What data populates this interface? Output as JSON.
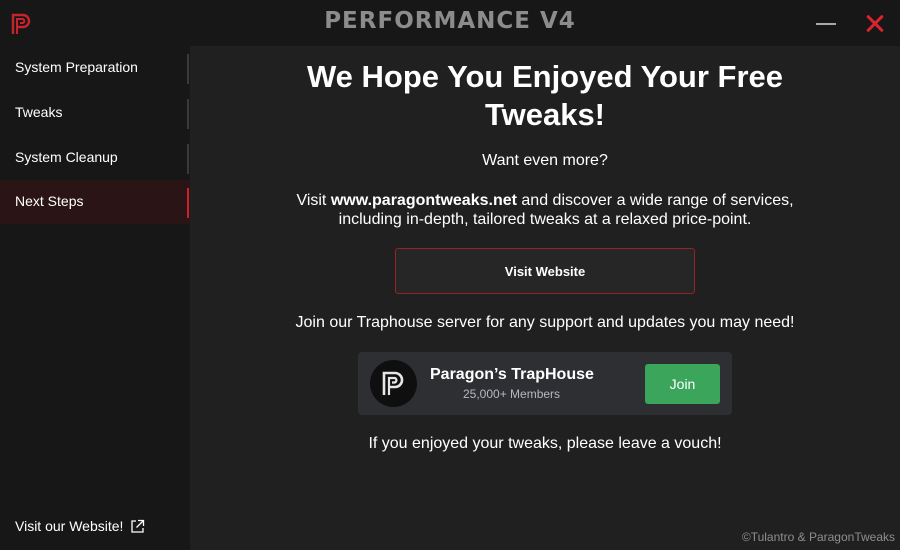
{
  "titlebar": {
    "title": "PERFORMANCE V4",
    "logo_icon": "paragon-logo-icon",
    "minimize_icon": "minimize-icon",
    "close_icon": "close-icon",
    "close_color": "#d8242c"
  },
  "sidebar": {
    "items": [
      {
        "label": "System Preparation",
        "active": false
      },
      {
        "label": "Tweaks",
        "active": false
      },
      {
        "label": "System Cleanup",
        "active": false
      },
      {
        "label": "Next Steps",
        "active": true
      }
    ],
    "visit_link": "Visit our Website!",
    "visit_icon": "external-link-icon",
    "accent": "#c8232b"
  },
  "main": {
    "headline_line1": "We Hope You Enjoyed Your Free",
    "headline_line2": "Tweaks!",
    "want_more": "Want even more?",
    "visit_prefix": "Visit ",
    "visit_site": "www.paragontweaks.net",
    "visit_suffix": " and discover a wide range of services,",
    "visit_line2": "including in-depth, tailored tweaks at a relaxed price-point.",
    "visit_button": "Visit Website",
    "join_text": "Join our Traphouse server for any support and updates you may need!",
    "server": {
      "name": "Paragon’s TrapHouse",
      "members": "25,000+ Members",
      "join_button": "Join",
      "join_color": "#3ba55c"
    },
    "vouch_text": "If you enjoyed your tweaks, please leave a vouch!",
    "copyright": "©Tulantro & ParagonTweaks"
  }
}
